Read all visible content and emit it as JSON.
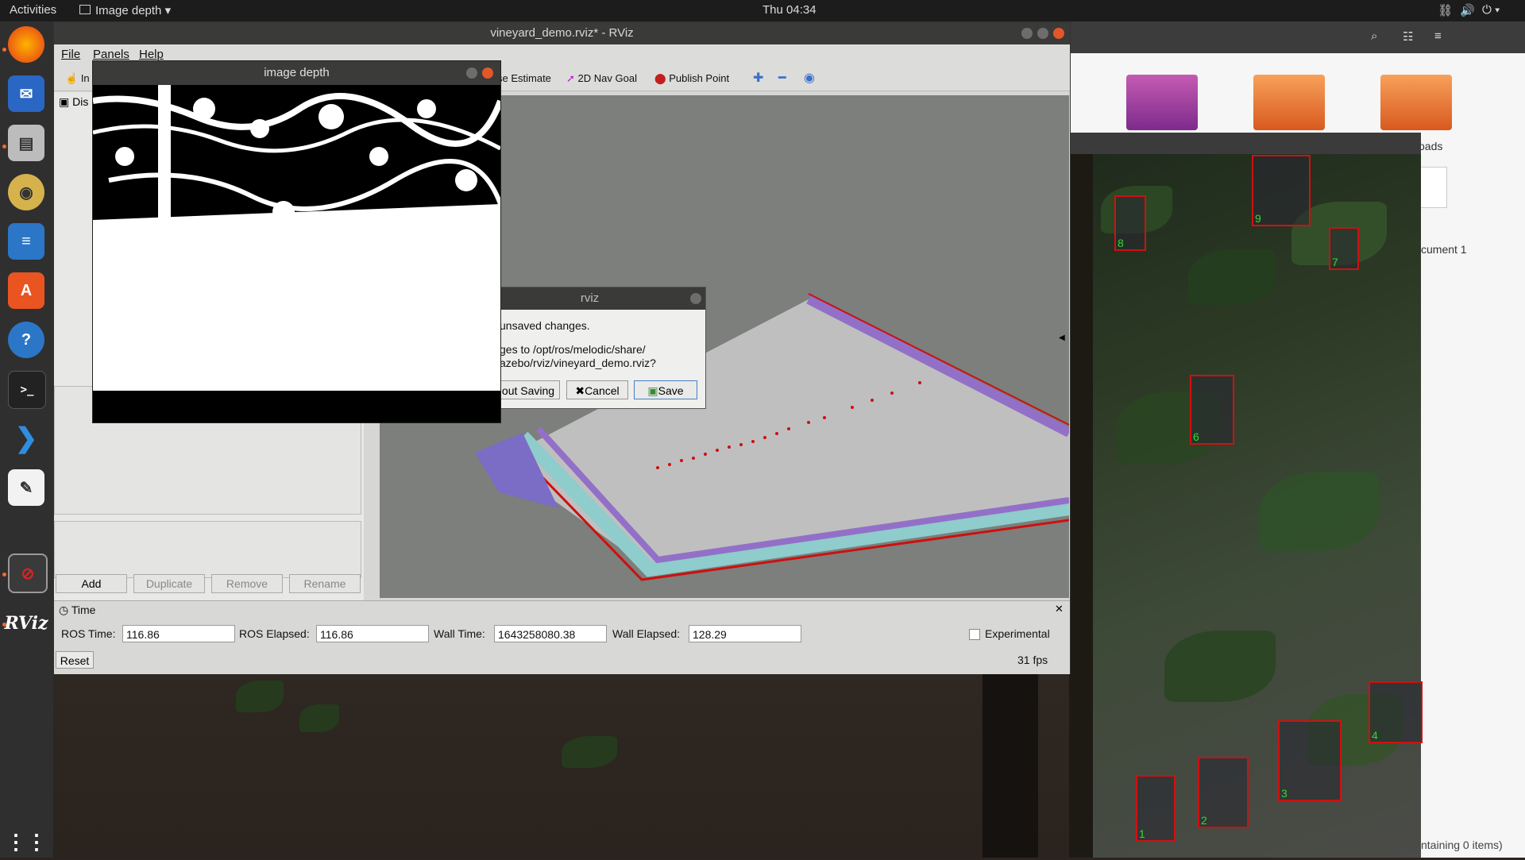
{
  "topbar": {
    "activities": "Activities",
    "app_menu": "Image depth",
    "clock": "Thu 04:34"
  },
  "dock": {
    "rviz_label": "RViz"
  },
  "files_window": {
    "folder_label_downloads": "oads",
    "doc_label": "cument 1",
    "status": "ntaining 0 items)"
  },
  "bounding_boxes": [
    "8",
    "9",
    "7",
    "6",
    "4",
    "3",
    "2",
    "1"
  ],
  "rviz": {
    "title": "vineyard_demo.rviz* - RViz",
    "menus": [
      "File",
      "Panels",
      "Help"
    ],
    "toolbar": {
      "interact": "In",
      "pose_estimate": "se Estimate",
      "nav_goal": "2D Nav Goal",
      "publish_point": "Publish Point"
    },
    "displays_label": "Dis",
    "buttons": {
      "add": "Add",
      "duplicate": "Duplicate",
      "remove": "Remove",
      "rename": "Rename"
    },
    "time_panel": {
      "title": "Time",
      "ros_time_label": "ROS Time:",
      "ros_time": "116.86",
      "ros_elapsed_label": "ROS Elapsed:",
      "ros_elapsed": "116.86",
      "wall_time_label": "Wall Time:",
      "wall_time": "1643258080.38",
      "wall_elapsed_label": "Wall Elapsed:",
      "wall_elapsed": "128.29",
      "experimental": "Experimental",
      "reset": "Reset",
      "fps": "31 fps"
    }
  },
  "image_depth": {
    "title": "image depth"
  },
  "dialog": {
    "title": "rviz",
    "line1": "unsaved changes.",
    "line2": "ges to /opt/ros/melodic/share/",
    "line3": "azebo/rviz/vineyard_demo.rviz?",
    "without_saving": "out Saving",
    "cancel": "Cancel",
    "save": "Save"
  }
}
